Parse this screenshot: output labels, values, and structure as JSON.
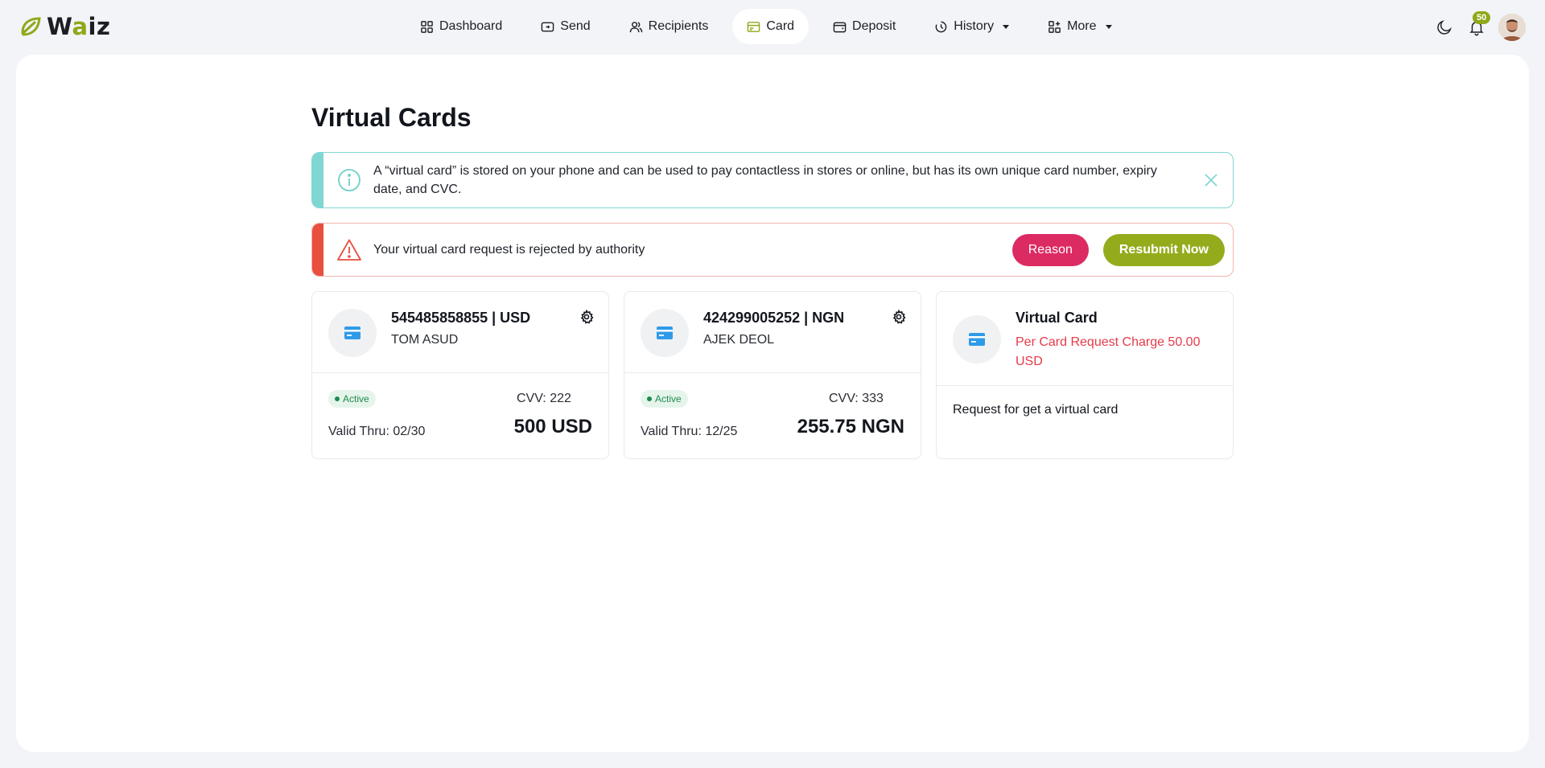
{
  "app": {
    "logo_prefix": "W",
    "logo_accent": "a",
    "logo_suffix": "iz",
    "accent_color": "#8fa819"
  },
  "nav": {
    "items": [
      {
        "label": "Dashboard",
        "icon": "grid-icon"
      },
      {
        "label": "Send",
        "icon": "send-icon"
      },
      {
        "label": "Recipients",
        "icon": "users-icon"
      },
      {
        "label": "Card",
        "icon": "card-icon",
        "active": true
      },
      {
        "label": "Deposit",
        "icon": "wallet-icon"
      },
      {
        "label": "History",
        "icon": "history-icon",
        "dropdown": true
      },
      {
        "label": "More",
        "icon": "apps-icon",
        "dropdown": true
      }
    ]
  },
  "header": {
    "notification_count": "50",
    "theme_icon": "moon-icon"
  },
  "page": {
    "title": "Virtual Cards"
  },
  "info_alert": {
    "text": "A “virtual card” is stored on your phone and can be used to pay contactless in stores or online, but has its own unique card number, expiry date, and CVC."
  },
  "danger_alert": {
    "text": "Your virtual card request is rejected by authority",
    "reason_label": "Reason",
    "resubmit_label": "Resubmit Now"
  },
  "cards": [
    {
      "number": "545485858855 | USD",
      "holder": "TOM ASUD",
      "status": "Active",
      "valid": "Valid Thru: 02/30",
      "cvv": "CVV: 222",
      "amount": "500 USD"
    },
    {
      "number": "424299005252 | NGN",
      "holder": "AJEK DEOL",
      "status": "Active",
      "valid": "Valid Thru: 12/25",
      "cvv": "CVV: 333",
      "amount": "255.75 NGN"
    }
  ],
  "request_card": {
    "title": "Virtual Card",
    "charge": "Per Card Request Charge 50.00 USD",
    "action": "Request for get a virtual card"
  }
}
